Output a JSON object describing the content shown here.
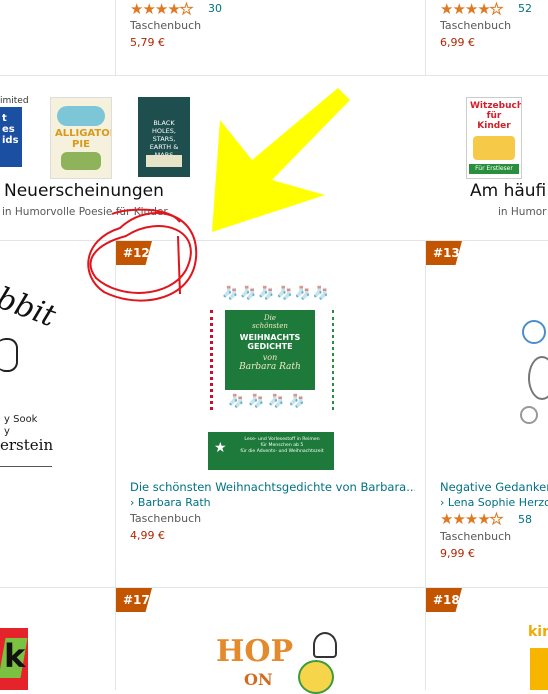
{
  "top_row": {
    "left": {
      "stars": "★★★★☆",
      "count": "30",
      "format": "Taschenbuch",
      "price": "5,79 €"
    },
    "right": {
      "stars": "★★★★☆",
      "count": "52",
      "format": "Taschenbuch",
      "price": "6,99 €"
    }
  },
  "category_row": {
    "unlimited_label": "imited",
    "left": {
      "heading": "Neuerscheinungen",
      "sub": "in Humorvolle Poesie für Kinder"
    },
    "right": {
      "heading": "Am häufi",
      "sub": "in Humor"
    },
    "cover1": {
      "text": "ALLIGATOR PIE"
    },
    "cover2": {
      "text": "BLACK HOLES, STARS, EARTH & MARS"
    },
    "cover3": {
      "title_a": "Witzebuch",
      "title_b": "für",
      "title_c": "Kinder",
      "sub": "Für Erstleser"
    },
    "left_partial_text": "t\nes\nids"
  },
  "product_row": {
    "left_partial": {
      "text1": "bbit",
      "text2": "y Sook\ny",
      "text3": "erstein"
    },
    "middle": {
      "rank": "#12",
      "cover_line1": "Die",
      "cover_line2": "schönsten",
      "cover_line3": "WEIHNACHTS",
      "cover_line4": "GEDICHTE",
      "cover_line5": "von",
      "cover_line6": "Barbara Rath",
      "cover_bottom": "Lese- und Vorlesestoff in Reimen\nfür Menschen ab 5\nfür die Advents- und Weihnachtszeit",
      "title": "Die schönsten Weihnachtsgedichte von Barbara...",
      "author": "› Barbara Rath",
      "format": "Taschenbuch",
      "price": "4,99 €"
    },
    "right": {
      "rank": "#13",
      "title": "Negative Gedanken",
      "author": "› Lena Sophie Herzog",
      "stars": "★★★★☆",
      "count": "58",
      "format": "Taschenbuch",
      "price": "9,99 €"
    }
  },
  "bottom_row": {
    "middle": {
      "rank": "#17",
      "cover_text1": "HOP",
      "cover_text2": "ON"
    },
    "right": {
      "rank": "#18",
      "cover_text": "kin"
    },
    "left": {
      "cover_text": "k"
    }
  },
  "colors": {
    "badge": "#c45500",
    "link": "#007185",
    "price": "#b12704",
    "star": "#de7921",
    "annotation_yellow": "#ffff00",
    "annotation_red": "#e0161c"
  }
}
